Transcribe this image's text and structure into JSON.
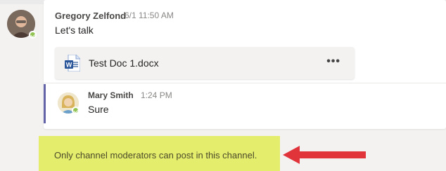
{
  "post": {
    "author": "Gregory Zelfond",
    "timestamp": "6/1 11:50 AM",
    "message": "Let's talk",
    "author_avatar_icon": "user-avatar",
    "presence": "available",
    "attachment": {
      "file_name": "Test Doc 1.docx",
      "file_icon": "word-doc-icon",
      "more_label": "•••"
    }
  },
  "reply": {
    "author": "Mary Smith",
    "timestamp": "1:24 PM",
    "message": "Sure",
    "presence": "available"
  },
  "notice": {
    "text": "Only channel moderators can post in this channel."
  },
  "colors": {
    "presence_available": "#92c353",
    "reply_accent": "#6264a7",
    "highlight": "#e5ed6c",
    "arrow": "#e0343a",
    "word_blue": "#2b579a"
  }
}
